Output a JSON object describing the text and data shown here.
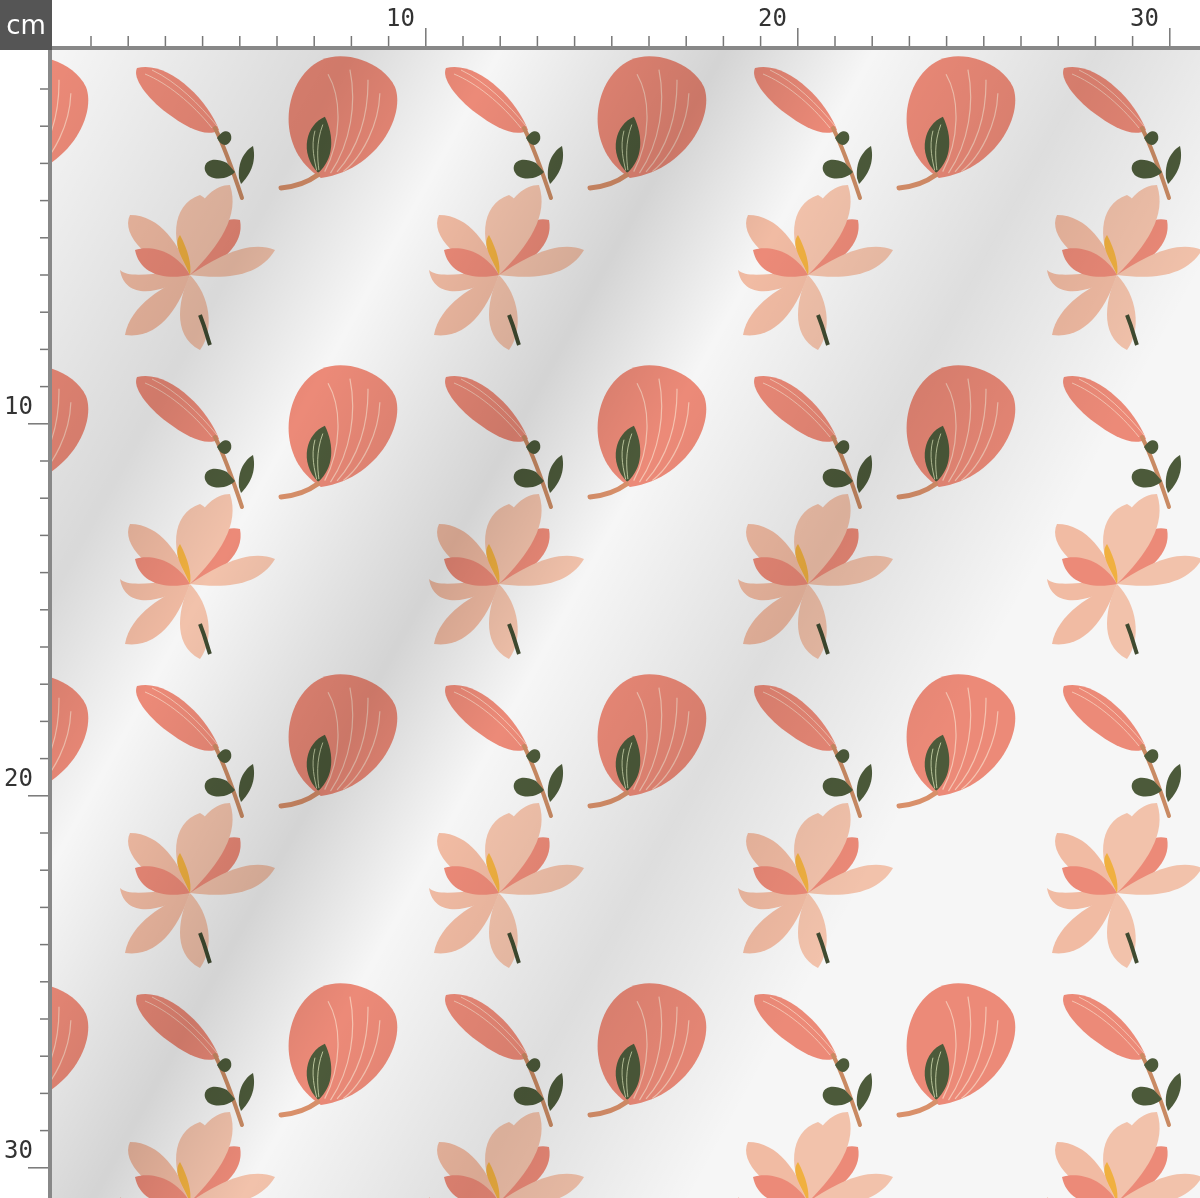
{
  "ruler": {
    "unit": "cm",
    "top_labels": [
      "10",
      "20",
      "30"
    ],
    "left_labels": [
      "10",
      "20",
      "30"
    ]
  }
}
